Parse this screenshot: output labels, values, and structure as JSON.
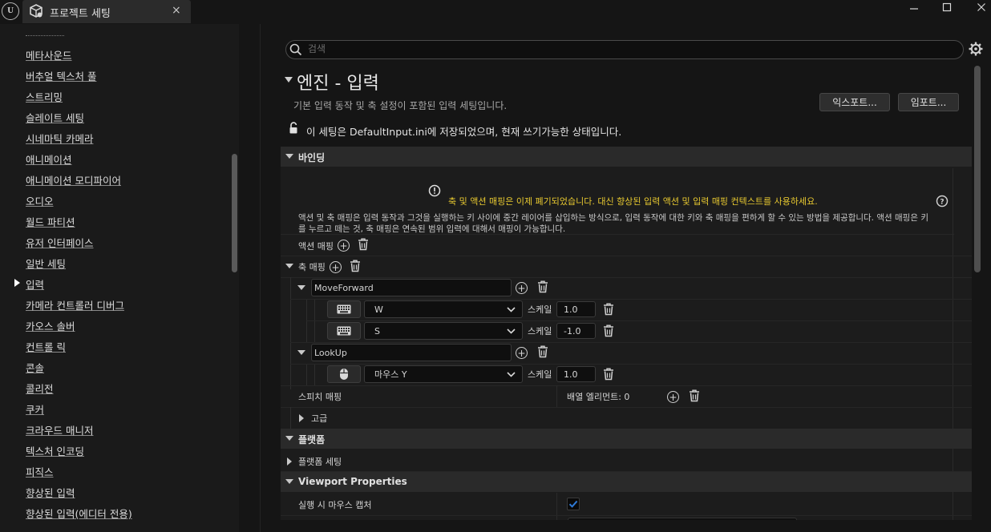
{
  "titlebar": {
    "tab_title": "프로젝트 세팅",
    "close_glyph": "×",
    "min_glyph": "—",
    "max_glyph": "☐",
    "wclose_glyph": "✕"
  },
  "sidebar": {
    "items": [
      {
        "label": "메타사운드"
      },
      {
        "label": "버추얼 텍스처 풀"
      },
      {
        "label": "스트리밍"
      },
      {
        "label": "슬레이트 세팅"
      },
      {
        "label": "시네마틱 카메라"
      },
      {
        "label": "애니메이션"
      },
      {
        "label": "애니메이션 모디파이어"
      },
      {
        "label": "오디오"
      },
      {
        "label": "월드 파티션"
      },
      {
        "label": "유저 인터페이스"
      },
      {
        "label": "일반 세팅"
      },
      {
        "label": "입력",
        "selected": true
      },
      {
        "label": "카메라 컨트롤러 디버그"
      },
      {
        "label": "카오스 솔버"
      },
      {
        "label": "컨트롤 릭"
      },
      {
        "label": "콘솔"
      },
      {
        "label": "콜리전"
      },
      {
        "label": "쿠커"
      },
      {
        "label": "크라우드 매니저"
      },
      {
        "label": "텍스처 인코딩"
      },
      {
        "label": "피직스"
      },
      {
        "label": "향상된 입력"
      },
      {
        "label": "향상된 입력(에디터 전용)"
      }
    ]
  },
  "search": {
    "placeholder": "검색"
  },
  "header": {
    "title": "엔진 - 입력",
    "subtitle": "기본 입력 동작 및 축 설정이 포함된 입력 세팅입니다.",
    "export_label": "익스포트...",
    "import_label": "임포트...",
    "config_status": "이 세팅은 DefaultInput.ini에 저장되었으며, 현재 쓰기가능한 상태입니다."
  },
  "bindings": {
    "section_label": "바인딩",
    "warning": "축 및 액션 매핑은 이제 폐기되었습니다. 대신 향상된 입력 액션 및 입력 매핑 컨텍스트를 사용하세요.",
    "description": "액션 및 축 매핑은 입력 동작과 그것을 실행하는 키 사이에 중간 레이어를 삽입하는 방식으로, 입력 동작에 대한 키와 축 매핑을 편하게 할 수 있는 방법을 제공합니다. 액션 매핑은 키를 누르고 떼는 것, 축 매핑은 연속된 범위 입력에 대해서 매핑이 가능합니다.",
    "action_mappings_label": "액션 매핑",
    "axis_mappings_label": "축 매핑",
    "scale_label": "스케일",
    "axis_mappings": [
      {
        "name": "MoveForward",
        "keys": [
          {
            "device": "keyboard-icon",
            "key": "W",
            "scale": "1.0"
          },
          {
            "device": "keyboard-icon",
            "key": "S",
            "scale": "-1.0"
          }
        ]
      },
      {
        "name": "LookUp",
        "keys": [
          {
            "device": "mouse-icon",
            "key": "마우스 Y",
            "scale": "1.0"
          }
        ]
      }
    ],
    "speech_mappings_label": "스피치 매핑",
    "array_elements": "배열 엘리먼트: 0",
    "advanced_label": "고급"
  },
  "platform": {
    "section_label": "플랫폼",
    "platform_settings_label": "플랫폼 세팅"
  },
  "viewport": {
    "section_label": "Viewport Properties",
    "capture_mouse_label": "실행 시 마우스 캡처",
    "capture_mouse_checked": true
  },
  "colors": {
    "warning": "#e8c930",
    "checkbox_check": "#2f7bd8"
  }
}
